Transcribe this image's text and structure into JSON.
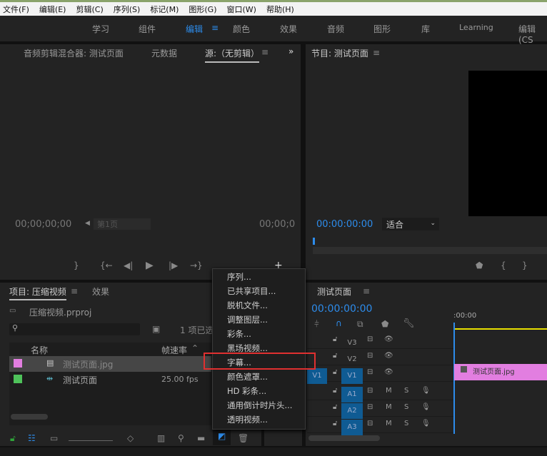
{
  "menubar": [
    "文件(F)",
    "编辑(E)",
    "剪辑(C)",
    "序列(S)",
    "标记(M)",
    "图形(G)",
    "窗口(W)",
    "帮助(H)"
  ],
  "workspaces": [
    "学习",
    "组件",
    "编辑",
    "颜色",
    "效果",
    "音频",
    "图形",
    "库",
    "Learning",
    "编辑 (CS"
  ],
  "source": {
    "tabs": [
      "音频剪辑混合器: 测试页面",
      "元数据",
      "源:（无剪辑）"
    ],
    "timecode_left": "00;00;00;00",
    "page": "第1页",
    "timecode_right": "00;00;0"
  },
  "program": {
    "title": "节目: 测试页面",
    "timecode": "00:00:00:00",
    "fit": "适合"
  },
  "project": {
    "tabs": [
      "项目: 压缩视频",
      "效果"
    ],
    "file": "压缩视频.prproj",
    "selected": "1 项已选",
    "col_name": "名称",
    "col_fps": "帧速率",
    "items": [
      {
        "name": "测试页面.jpg",
        "fps": "",
        "color": "#e27ee0"
      },
      {
        "name": "测试页面",
        "fps": "25.00 fps",
        "color": "#4ec25a"
      }
    ]
  },
  "menu": {
    "items": [
      "序列...",
      "已共享项目...",
      "脱机文件...",
      "调整图层...",
      "彩条...",
      "黑场视频...",
      "字幕...",
      "颜色遮罩...",
      "HD 彩条...",
      "通用倒计时片头...",
      "透明视频..."
    ],
    "highlighted": "字幕..."
  },
  "timeline": {
    "title": "测试页面",
    "timecode": "00:00:00:00",
    "ruler": ":00:00",
    "video_tracks": [
      "V3",
      "V2",
      "V1"
    ],
    "audio_tracks": [
      "A1",
      "A2",
      "A3"
    ],
    "source_patch": "V1",
    "clip": "测试页面.jpg",
    "m": "M",
    "s": "S"
  },
  "colors": {
    "accent": "#2d8ceb",
    "clip": "#e27ee0",
    "highlight_box": "#e03030"
  }
}
